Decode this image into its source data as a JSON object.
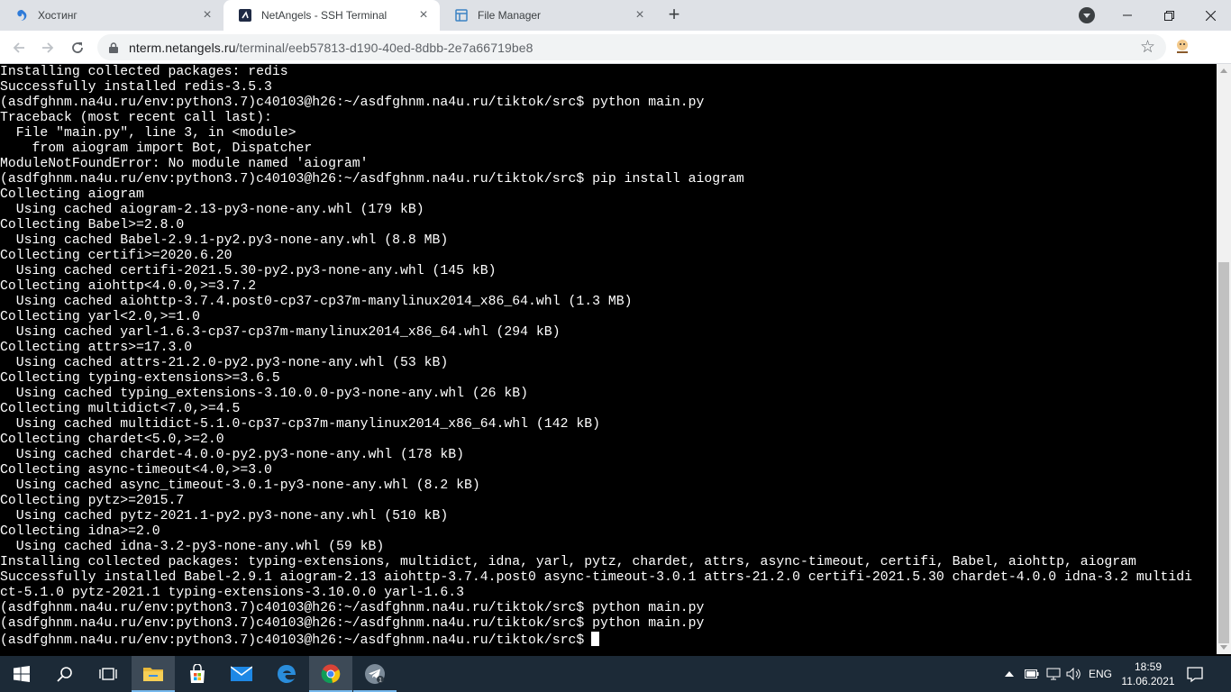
{
  "browser": {
    "tabs": [
      {
        "title": "Хостинг",
        "icon": "netangels-swirl-icon",
        "active": false
      },
      {
        "title": "NetAngels - SSH Terminal",
        "icon": "netangels-terminal-icon",
        "active": true
      },
      {
        "title": "File Manager",
        "icon": "file-manager-icon",
        "active": false
      }
    ],
    "url_host": "nterm.netangels.ru",
    "url_path": "/terminal/eeb57813-d190-40ed-8dbb-2e7a66719be8"
  },
  "terminal": {
    "lines": [
      "Installing collected packages: redis",
      "Successfully installed redis-3.5.3",
      "(asdfghnm.na4u.ru/env:python3.7)c40103@h26:~/asdfghnm.na4u.ru/tiktok/src$ python main.py",
      "Traceback (most recent call last):",
      "  File \"main.py\", line 3, in <module>",
      "    from aiogram import Bot, Dispatcher",
      "ModuleNotFoundError: No module named 'aiogram'",
      "(asdfghnm.na4u.ru/env:python3.7)c40103@h26:~/asdfghnm.na4u.ru/tiktok/src$ pip install aiogram",
      "Collecting aiogram",
      "  Using cached aiogram-2.13-py3-none-any.whl (179 kB)",
      "Collecting Babel>=2.8.0",
      "  Using cached Babel-2.9.1-py2.py3-none-any.whl (8.8 MB)",
      "Collecting certifi>=2020.6.20",
      "  Using cached certifi-2021.5.30-py2.py3-none-any.whl (145 kB)",
      "Collecting aiohttp<4.0.0,>=3.7.2",
      "  Using cached aiohttp-3.7.4.post0-cp37-cp37m-manylinux2014_x86_64.whl (1.3 MB)",
      "Collecting yarl<2.0,>=1.0",
      "  Using cached yarl-1.6.3-cp37-cp37m-manylinux2014_x86_64.whl (294 kB)",
      "Collecting attrs>=17.3.0",
      "  Using cached attrs-21.2.0-py2.py3-none-any.whl (53 kB)",
      "Collecting typing-extensions>=3.6.5",
      "  Using cached typing_extensions-3.10.0.0-py3-none-any.whl (26 kB)",
      "Collecting multidict<7.0,>=4.5",
      "  Using cached multidict-5.1.0-cp37-cp37m-manylinux2014_x86_64.whl (142 kB)",
      "Collecting chardet<5.0,>=2.0",
      "  Using cached chardet-4.0.0-py2.py3-none-any.whl (178 kB)",
      "Collecting async-timeout<4.0,>=3.0",
      "  Using cached async_timeout-3.0.1-py3-none-any.whl (8.2 kB)",
      "Collecting pytz>=2015.7",
      "  Using cached pytz-2021.1-py2.py3-none-any.whl (510 kB)",
      "Collecting idna>=2.0",
      "  Using cached idna-3.2-py3-none-any.whl (59 kB)",
      "Installing collected packages: typing-extensions, multidict, idna, yarl, pytz, chardet, attrs, async-timeout, certifi, Babel, aiohttp, aiogram",
      "Successfully installed Babel-2.9.1 aiogram-2.13 aiohttp-3.7.4.post0 async-timeout-3.0.1 attrs-21.2.0 certifi-2021.5.30 chardet-4.0.0 idna-3.2 multidi",
      "ct-5.1.0 pytz-2021.1 typing-extensions-3.10.0.0 yarl-1.6.3",
      "(asdfghnm.na4u.ru/env:python3.7)c40103@h26:~/asdfghnm.na4u.ru/tiktok/src$ python main.py",
      "(asdfghnm.na4u.ru/env:python3.7)c40103@h26:~/asdfghnm.na4u.ru/tiktok/src$ python main.py"
    ],
    "prompt": "(asdfghnm.na4u.ru/env:python3.7)c40103@h26:~/asdfghnm.na4u.ru/tiktok/src$"
  },
  "taskbar": {
    "apps": [
      {
        "name": "start-icon"
      },
      {
        "name": "search-icon"
      },
      {
        "name": "task-view-icon"
      },
      {
        "name": "file-explorer-icon"
      },
      {
        "name": "store-icon"
      },
      {
        "name": "mail-icon"
      },
      {
        "name": "edge-icon"
      },
      {
        "name": "chrome-icon"
      },
      {
        "name": "telegram-icon"
      }
    ],
    "language": "ENG",
    "time": "18:59",
    "date": "11.06.2021"
  }
}
